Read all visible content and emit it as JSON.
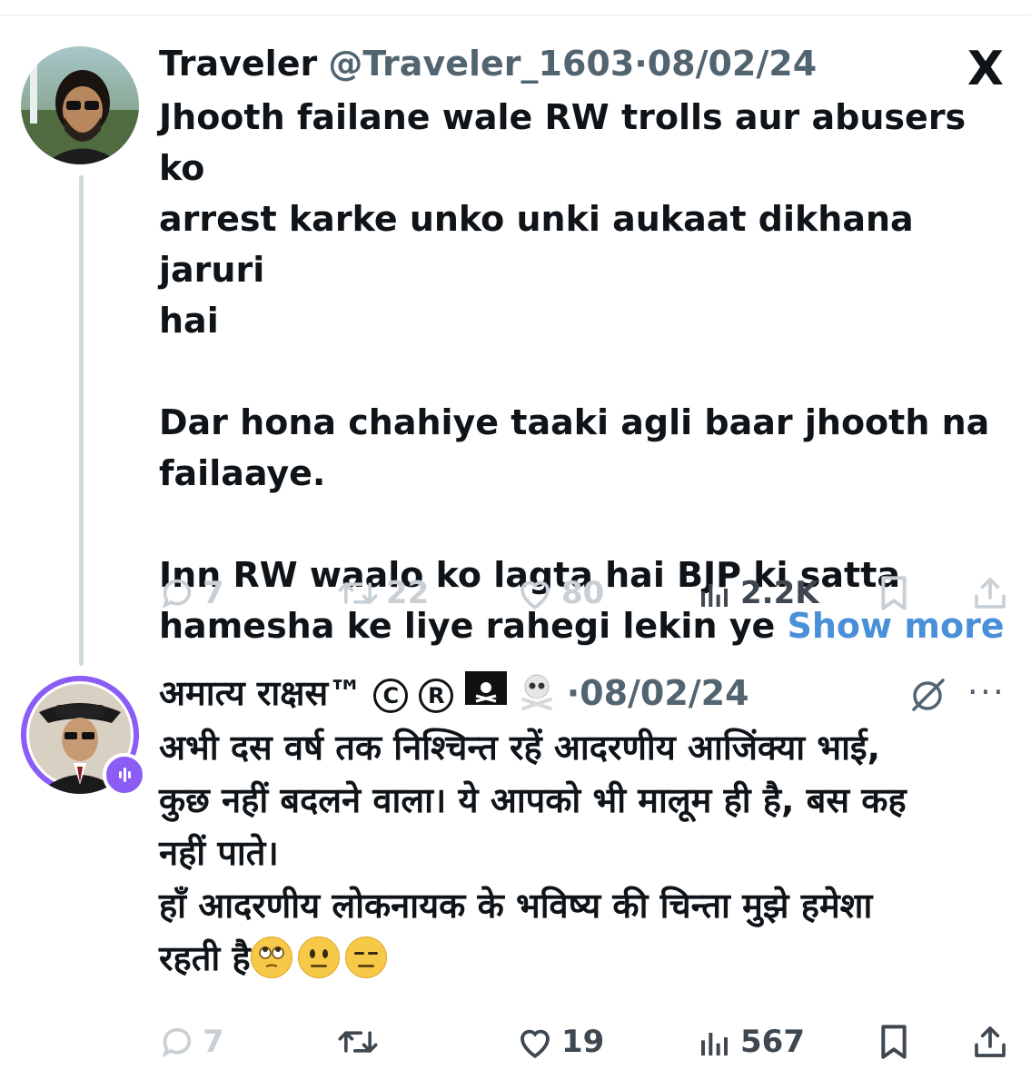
{
  "tweet1": {
    "name": "Traveler",
    "handle": "@Traveler_1603",
    "separator": "·",
    "date": "08/02/24",
    "text": "Jhooth failane wale RW trolls aur abusers ko\narrest karke unko unki aukaat dikhana jaruri\nhai\n\nDar hona chahiye taaki agli baar jhooth na\nfailaaye.\n\nInn RW waalo ko lagta hai BJP ki satta\nhamesha ke liye rahegi lekin ye ",
    "show_more": "Show more",
    "replies": "7",
    "retweets": "22",
    "likes": "80",
    "views": "2.2K",
    "platform_icon": "X"
  },
  "tweet2": {
    "name": "अमात्य राक्षस™",
    "badge_c": "C",
    "badge_r": "R",
    "separator": "·",
    "date": "08/02/24",
    "more_icon": "···",
    "lines": [
      "अभी दस वर्ष तक निश्चिन्त रहें आदरणीय आजिंक्या भाई,",
      "कुछ नहीं बदलने वाला। ये आपको भी मालूम ही है, बस कह",
      "नहीं पाते।",
      "हाँ आदरणीय लोकनायक के भविष्य की चिन्ता मुझे हमेशा",
      "रहती है"
    ],
    "replies": "7",
    "likes": "19",
    "views": "567"
  },
  "icons": {
    "reply": "reply-icon",
    "retweet": "retweet-icon",
    "like": "heart-icon",
    "views": "views-icon",
    "bookmark": "bookmark-icon",
    "share": "share-icon",
    "grok": "grok-icon"
  },
  "colors": {
    "link": "#4a90d9",
    "secondary": "#536471",
    "avatar_ring": "#8b5cf6",
    "faded": "#c9d0d5"
  }
}
